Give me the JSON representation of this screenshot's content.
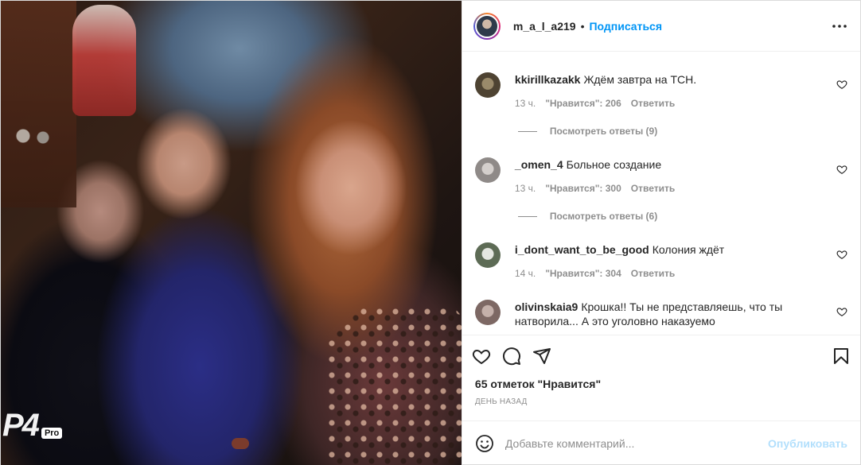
{
  "post": {
    "watermark_text": "P4",
    "watermark_badge": "Pro"
  },
  "header": {
    "username": "m_a_l_a219",
    "separator": "•",
    "follow_label": "Подписаться",
    "more_icon": "more-horizontal-icon"
  },
  "comments": [
    {
      "username": "kkirillkazakk",
      "text": "Ждём завтра на ТСН.",
      "time": "13 ч.",
      "likes": "\"Нравится\": 206",
      "reply_label": "Ответить",
      "view_replies": "Посмотреть ответы (9)",
      "avatar_color": "#6b5a3e"
    },
    {
      "username": "_omen_4",
      "text": "Больное создание",
      "time": "13 ч.",
      "likes": "\"Нравится\": 300",
      "reply_label": "Ответить",
      "view_replies": "Посмотреть ответы (6)",
      "avatar_color": "#b9b3b0"
    },
    {
      "username": "i_dont_want_to_be_good",
      "text": "Колония ждёт",
      "time": "14 ч.",
      "likes": "\"Нравится\": 304",
      "reply_label": "Ответить",
      "avatar_color": "#7a8a70"
    },
    {
      "username": "olivinskaia9",
      "text": "Крошка!! Ты не представляешь, что ты натворила... А это уголовно наказуемо",
      "avatar_color": "#9c8a86"
    }
  ],
  "actions": {
    "like_icon": "heart-icon",
    "comment_icon": "comment-icon",
    "share_icon": "share-icon",
    "save_icon": "bookmark-icon"
  },
  "likes_count": "65 отметок \"Нравится\"",
  "timestamp": "ДЕНЬ НАЗАД",
  "add_comment": {
    "placeholder": "Добавьте комментарий...",
    "publish_label": "Опубликовать",
    "emoji_icon": "emoji-icon"
  },
  "colors": {
    "accent": "#0095f6",
    "publish_disabled": "#b2dffc",
    "muted": "#8e8e8e"
  }
}
